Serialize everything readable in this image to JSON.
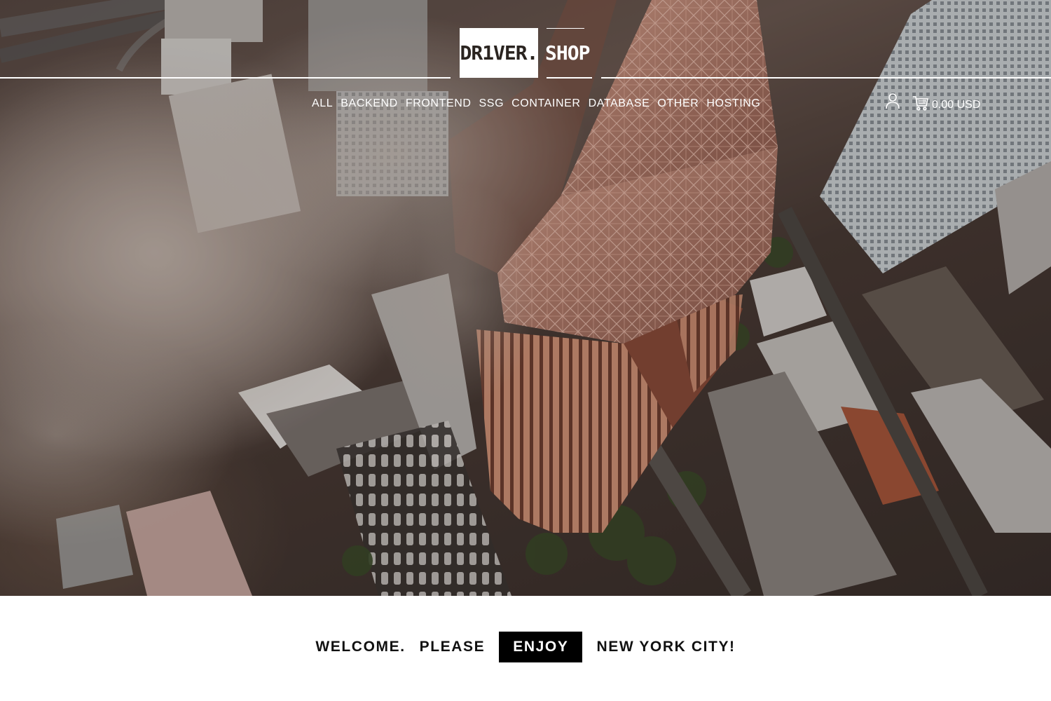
{
  "header": {
    "logo_box_text": "DR1VER.",
    "logo_shop_text": "SHOP",
    "nav_items": [
      {
        "label": "ALL"
      },
      {
        "label": "BACKEND"
      },
      {
        "label": "FRONTEND"
      },
      {
        "label": "SSG"
      },
      {
        "label": "CONTAINER"
      },
      {
        "label": "DATABASE"
      },
      {
        "label": "OTHER"
      },
      {
        "label": "HOSTING"
      }
    ],
    "account_icon": "user-icon",
    "cart_icon": "shopping-cart-icon",
    "cart_amount": "0.00 USD"
  },
  "hero": {
    "image_subject": "aerial-skyscraper-in-fog"
  },
  "banner": {
    "word_1": "WELCOME.",
    "word_2": "PLEASE",
    "word_3": "ENJOY",
    "word_4": "NEW YORK CITY!"
  },
  "colors": {
    "header_text": "#ffffff",
    "logo_box_bg": "#ffffff",
    "logo_box_text": "#2a2420",
    "banner_bg": "#ffffff",
    "banner_text": "#111111",
    "highlight_bg": "#000000",
    "highlight_text": "#ffffff"
  }
}
